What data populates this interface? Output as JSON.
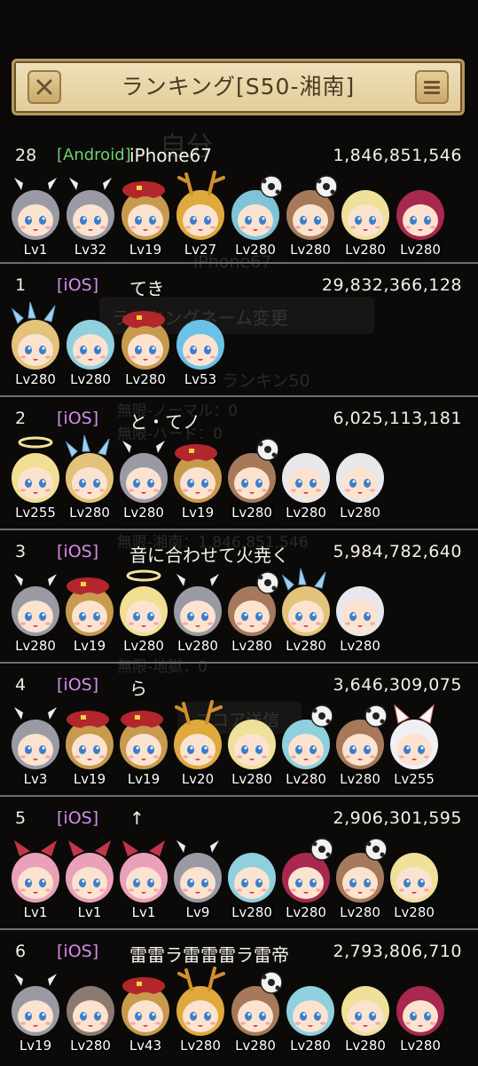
{
  "header": {
    "title": "ランキング[S50-湘南]",
    "close_icon": "close-icon",
    "menu_icon": "menu-icon"
  },
  "colors": {
    "background": "#0b0a09",
    "header_bg": "#e8d6a8",
    "ios_tag": "#d58be8",
    "android_tag": "#6fcf6f",
    "divider": "#6e6e6e"
  },
  "ghost": {
    "name_title": "自分",
    "device": "iPhone67",
    "rename_button": "ランキングネーム変更",
    "rank_label": "ランキン50",
    "infinite_normal": "無限-ノーマル：0",
    "infinite_hard": "無限-ハード：0",
    "infinite_shonan": "無限-湘南：1,846,851,546",
    "infinite_hell": "無限-地獄：0",
    "score_button": "スコア送信"
  },
  "rows": [
    {
      "rank": "28",
      "platform": "[Android]",
      "name": "iPhone67",
      "score": "1,846,851,546",
      "characters": [
        {
          "lv": "Lv1",
          "hair": "#9a9aa4",
          "hat": "wing"
        },
        {
          "lv": "Lv32",
          "hair": "#9a9aa4",
          "hat": "wing"
        },
        {
          "lv": "Lv19",
          "hair": "#c79a4e",
          "hat": "beret"
        },
        {
          "lv": "Lv27",
          "hair": "#e0a93d",
          "hat": "antler"
        },
        {
          "lv": "Lv280",
          "hair": "#7fc3d9",
          "hat": "ball"
        },
        {
          "lv": "Lv280",
          "hair": "#a6795a",
          "hat": "ball"
        },
        {
          "lv": "Lv280",
          "hair": "#efe09a",
          "hat": "none"
        },
        {
          "lv": "Lv280",
          "hair": "#a8284f",
          "hat": "none"
        }
      ]
    },
    {
      "rank": "1",
      "platform": "[iOS]",
      "name": "てき",
      "score": "29,832,366,128",
      "characters": [
        {
          "lv": "Lv280",
          "hair": "#e3c27a",
          "hat": "crystal"
        },
        {
          "lv": "Lv280",
          "hair": "#8fd0df",
          "hat": "none"
        },
        {
          "lv": "Lv280",
          "hair": "#c79a4e",
          "hat": "beret"
        },
        {
          "lv": "Lv53",
          "hair": "#6cc2e6",
          "hat": "none"
        }
      ]
    },
    {
      "rank": "2",
      "platform": "[iOS]",
      "name": "と・てノ",
      "score": "6,025,113,181",
      "characters": [
        {
          "lv": "Lv255",
          "hair": "#f1df94",
          "hat": "halo"
        },
        {
          "lv": "Lv280",
          "hair": "#e3c27a",
          "hat": "crystal"
        },
        {
          "lv": "Lv280",
          "hair": "#9a9aa4",
          "hat": "wing"
        },
        {
          "lv": "Lv19",
          "hair": "#c79a4e",
          "hat": "beret"
        },
        {
          "lv": "Lv280",
          "hair": "#a6795a",
          "hat": "ball"
        },
        {
          "lv": "Lv280",
          "hair": "#e8e8ec",
          "hat": "none"
        },
        {
          "lv": "Lv280",
          "hair": "#e8e8ec",
          "hat": "none"
        }
      ]
    },
    {
      "rank": "3",
      "platform": "[iOS]",
      "name": "音に合わせて火尭く",
      "score": "5,984,782,640",
      "characters": [
        {
          "lv": "Lv280",
          "hair": "#9a9aa4",
          "hat": "wing"
        },
        {
          "lv": "Lv19",
          "hair": "#c79a4e",
          "hat": "beret"
        },
        {
          "lv": "Lv280",
          "hair": "#f1df94",
          "hat": "halo"
        },
        {
          "lv": "Lv280",
          "hair": "#9a9aa4",
          "hat": "wing"
        },
        {
          "lv": "Lv280",
          "hair": "#a6795a",
          "hat": "ball"
        },
        {
          "lv": "Lv280",
          "hair": "#e3c27a",
          "hat": "crystal"
        },
        {
          "lv": "Lv280",
          "hair": "#e8e8ec",
          "hat": "none"
        }
      ]
    },
    {
      "rank": "4",
      "platform": "[iOS]",
      "name": "ら",
      "score": "3,646,309,075",
      "characters": [
        {
          "lv": "Lv3",
          "hair": "#9a9aa4",
          "hat": "wing"
        },
        {
          "lv": "Lv19",
          "hair": "#c79a4e",
          "hat": "beret"
        },
        {
          "lv": "Lv19",
          "hair": "#c79a4e",
          "hat": "beret"
        },
        {
          "lv": "Lv20",
          "hair": "#e0a93d",
          "hat": "antler"
        },
        {
          "lv": "Lv280",
          "hair": "#efe09a",
          "hat": "none"
        },
        {
          "lv": "Lv280",
          "hair": "#8fd0df",
          "hat": "ball"
        },
        {
          "lv": "Lv280",
          "hair": "#a6795a",
          "hat": "ball"
        },
        {
          "lv": "Lv255",
          "hair": "#f0f0f4",
          "hat": "ears"
        }
      ]
    },
    {
      "rank": "5",
      "platform": "[iOS]",
      "name": "↑",
      "score": "2,906,301,595",
      "characters": [
        {
          "lv": "Lv1",
          "hair": "#eaa0b8",
          "hat": "ears-red"
        },
        {
          "lv": "Lv1",
          "hair": "#eaa0b8",
          "hat": "ears-red"
        },
        {
          "lv": "Lv1",
          "hair": "#eaa0b8",
          "hat": "ears-red"
        },
        {
          "lv": "Lv9",
          "hair": "#9a9aa4",
          "hat": "wing"
        },
        {
          "lv": "Lv280",
          "hair": "#8fd0df",
          "hat": "none"
        },
        {
          "lv": "Lv280",
          "hair": "#a8284f",
          "hat": "ball"
        },
        {
          "lv": "Lv280",
          "hair": "#a6795a",
          "hat": "ball"
        },
        {
          "lv": "Lv280",
          "hair": "#efe09a",
          "hat": "none"
        }
      ]
    },
    {
      "rank": "6",
      "platform": "[iOS]",
      "name": "雷雷ラ雷雷雷ラ雷帝",
      "score": "2,793,806,710",
      "characters": [
        {
          "lv": "Lv19",
          "hair": "#9a9aa4",
          "hat": "wing"
        },
        {
          "lv": "Lv280",
          "hair": "#8a7a70",
          "hat": "none"
        },
        {
          "lv": "Lv43",
          "hair": "#c79a4e",
          "hat": "beret"
        },
        {
          "lv": "Lv280",
          "hair": "#e0a93d",
          "hat": "antler"
        },
        {
          "lv": "Lv280",
          "hair": "#a6795a",
          "hat": "ball"
        },
        {
          "lv": "Lv280",
          "hair": "#8fd0df",
          "hat": "none"
        },
        {
          "lv": "Lv280",
          "hair": "#efe09a",
          "hat": "none"
        },
        {
          "lv": "Lv280",
          "hair": "#a8284f",
          "hat": "none"
        }
      ]
    }
  ]
}
